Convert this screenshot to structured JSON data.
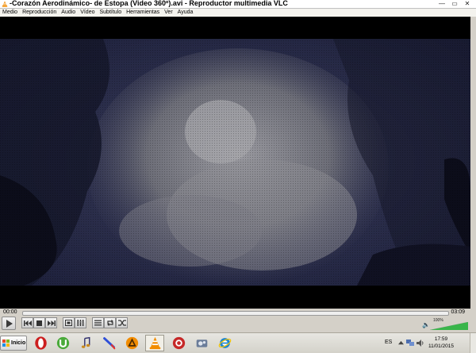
{
  "window": {
    "title": "-Corazón Aerodinámico- de Estopa (Video 360º).avi - Reproductor multimedia VLC",
    "controls": {
      "minimize": "—",
      "maximize": "▭",
      "close": "✕"
    }
  },
  "menu": {
    "items": [
      {
        "label": "Medio"
      },
      {
        "label": "Reproducción"
      },
      {
        "label": "Audio"
      },
      {
        "label": "Vídeo"
      },
      {
        "label": "Subtítulo"
      },
      {
        "label": "Herramientas"
      },
      {
        "label": "Ver"
      },
      {
        "label": "Ayuda"
      }
    ]
  },
  "player": {
    "time_current": "00:00",
    "time_total": "03:09",
    "progress": 0,
    "volume_label": "100%",
    "volume": 1.0,
    "buttons": [
      {
        "name": "play-button",
        "icon": "play-icon"
      },
      {
        "name": "previous-button",
        "icon": "skip-back-icon"
      },
      {
        "name": "stop-button",
        "icon": "stop-icon"
      },
      {
        "name": "next-button",
        "icon": "skip-forward-icon"
      },
      {
        "name": "fullscreen-button",
        "icon": "fullscreen-icon"
      },
      {
        "name": "extended-settings-button",
        "icon": "equalizer-icon"
      },
      {
        "name": "playlist-button",
        "icon": "playlist-icon"
      },
      {
        "name": "loop-button",
        "icon": "loop-icon"
      },
      {
        "name": "shuffle-button",
        "icon": "shuffle-icon"
      }
    ]
  },
  "taskbar": {
    "start_label": "Inicio",
    "apps": [
      {
        "name": "opera",
        "icon": "opera-icon"
      },
      {
        "name": "utorrent",
        "icon": "utorrent-icon"
      },
      {
        "name": "music-app",
        "icon": "music-note-icon"
      },
      {
        "name": "pen-app",
        "icon": "pen-icon"
      },
      {
        "name": "avast",
        "icon": "avast-icon"
      },
      {
        "name": "vlc",
        "icon": "vlc-cone-icon",
        "active": true
      },
      {
        "name": "red-app",
        "icon": "red-circle-icon"
      },
      {
        "name": "tools-app",
        "icon": "gears-icon"
      },
      {
        "name": "ie",
        "icon": "internet-explorer-icon"
      }
    ],
    "language": "ES",
    "clock_time": "17:59",
    "clock_date": "11/01/2015"
  },
  "colors": {
    "vlc_orange": "#f28c00",
    "opera_red": "#cc1f1f",
    "utorrent_green": "#4aaa3a",
    "volume_green": "#39b54a",
    "seek_blue": "#5b9bd5"
  }
}
